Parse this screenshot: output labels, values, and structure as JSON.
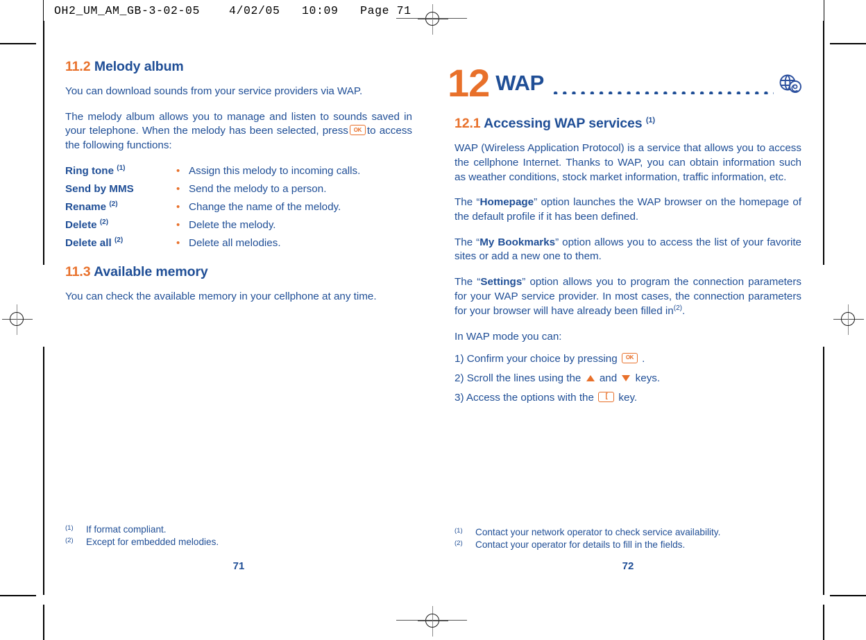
{
  "slug": {
    "text": "OH2_UM_AM_GB-3-02-05    4/02/05   10:09   Page 71"
  },
  "left_page": {
    "sections": [
      {
        "number": "11.2",
        "title": "Melody album",
        "paragraphs": [
          "You can download sounds from your service providers via WAP.",
          "The melody album allows you to manage and listen to sounds saved in your telephone. When the melody has been selected, press"
        ],
        "paragraph2_tail": "to access the following functions:"
      },
      {
        "number": "11.3",
        "title": "Available memory",
        "paragraphs": [
          "You can check the available memory in your cellphone at any time."
        ]
      }
    ],
    "definition_list": [
      {
        "term": "Ring tone",
        "sup": "(1)",
        "bullet": "•",
        "desc": "Assign this melody to incoming calls."
      },
      {
        "term": "Send by MMS",
        "sup": "",
        "bullet": "•",
        "desc": "Send the melody to a person."
      },
      {
        "term": "Rename",
        "sup": "(2)",
        "bullet": "•",
        "desc": "Change the name of the melody."
      },
      {
        "term": "Delete",
        "sup": "(2)",
        "bullet": "•",
        "desc": "Delete the melody."
      },
      {
        "term": "Delete all",
        "sup": "(2)",
        "bullet": "•",
        "desc": "Delete all melodies."
      }
    ],
    "footnotes": [
      {
        "mark": "(1)",
        "text": "If format compliant."
      },
      {
        "mark": "(2)",
        "text": "Except for embedded melodies."
      }
    ],
    "folio": "71"
  },
  "right_page": {
    "chapter": {
      "number": "12",
      "name": "WAP",
      "icon": "globe-at-icon"
    },
    "section": {
      "number": "12.1",
      "title": "Accessing WAP services",
      "sup": "(1)"
    },
    "paragraphs": [
      {
        "id": "intro",
        "text": "WAP (Wireless Application Protocol) is a service that allows you to access the cellphone Internet. Thanks to WAP, you can obtain information such as weather conditions, stock market information, traffic information, etc."
      },
      {
        "id": "homepage",
        "prefix": "The “",
        "bold": "Homepage",
        "suffix": "” option launches the WAP browser on the homepage of the default profile if it has been defined."
      },
      {
        "id": "bookmarks",
        "prefix": "The “",
        "bold": "My Bookmarks",
        "suffix": "” option allows you to access the list of your favorite sites or add a new one to them."
      },
      {
        "id": "settings",
        "prefix": "The “",
        "bold": "Settings",
        "suffix": "” option allows you to program the connection parameters for your WAP service provider. In most cases, the connection parameters for your browser will have already been filled in",
        "sup": "(2)",
        "tail": "."
      }
    ],
    "steps_intro": "In WAP mode you can:",
    "steps": [
      {
        "label": "1)",
        "text": "Confirm your choice by pressing",
        "icon": "ok-key-icon",
        "tail": "."
      },
      {
        "label": "2)",
        "text": "Scroll the lines using the",
        "icon": "up-arrow-key-icon",
        "mid": "and",
        "icon2": "down-arrow-key-icon",
        "tail": "keys."
      },
      {
        "label": "3)",
        "text": "Access the options with the",
        "icon": "left-soft-key-icon",
        "tail": "key."
      }
    ],
    "footnotes": [
      {
        "mark": "(1)",
        "text": "Contact your network operator to check service availability."
      },
      {
        "mark": "(2)",
        "text": "Contact your operator for details to fill in the fields."
      }
    ],
    "folio": "72"
  },
  "keys": {
    "ok_label": "OK",
    "soft_label": "["
  },
  "colors": {
    "accent_orange": "#e8702a",
    "text_blue": "#1f4e96"
  }
}
